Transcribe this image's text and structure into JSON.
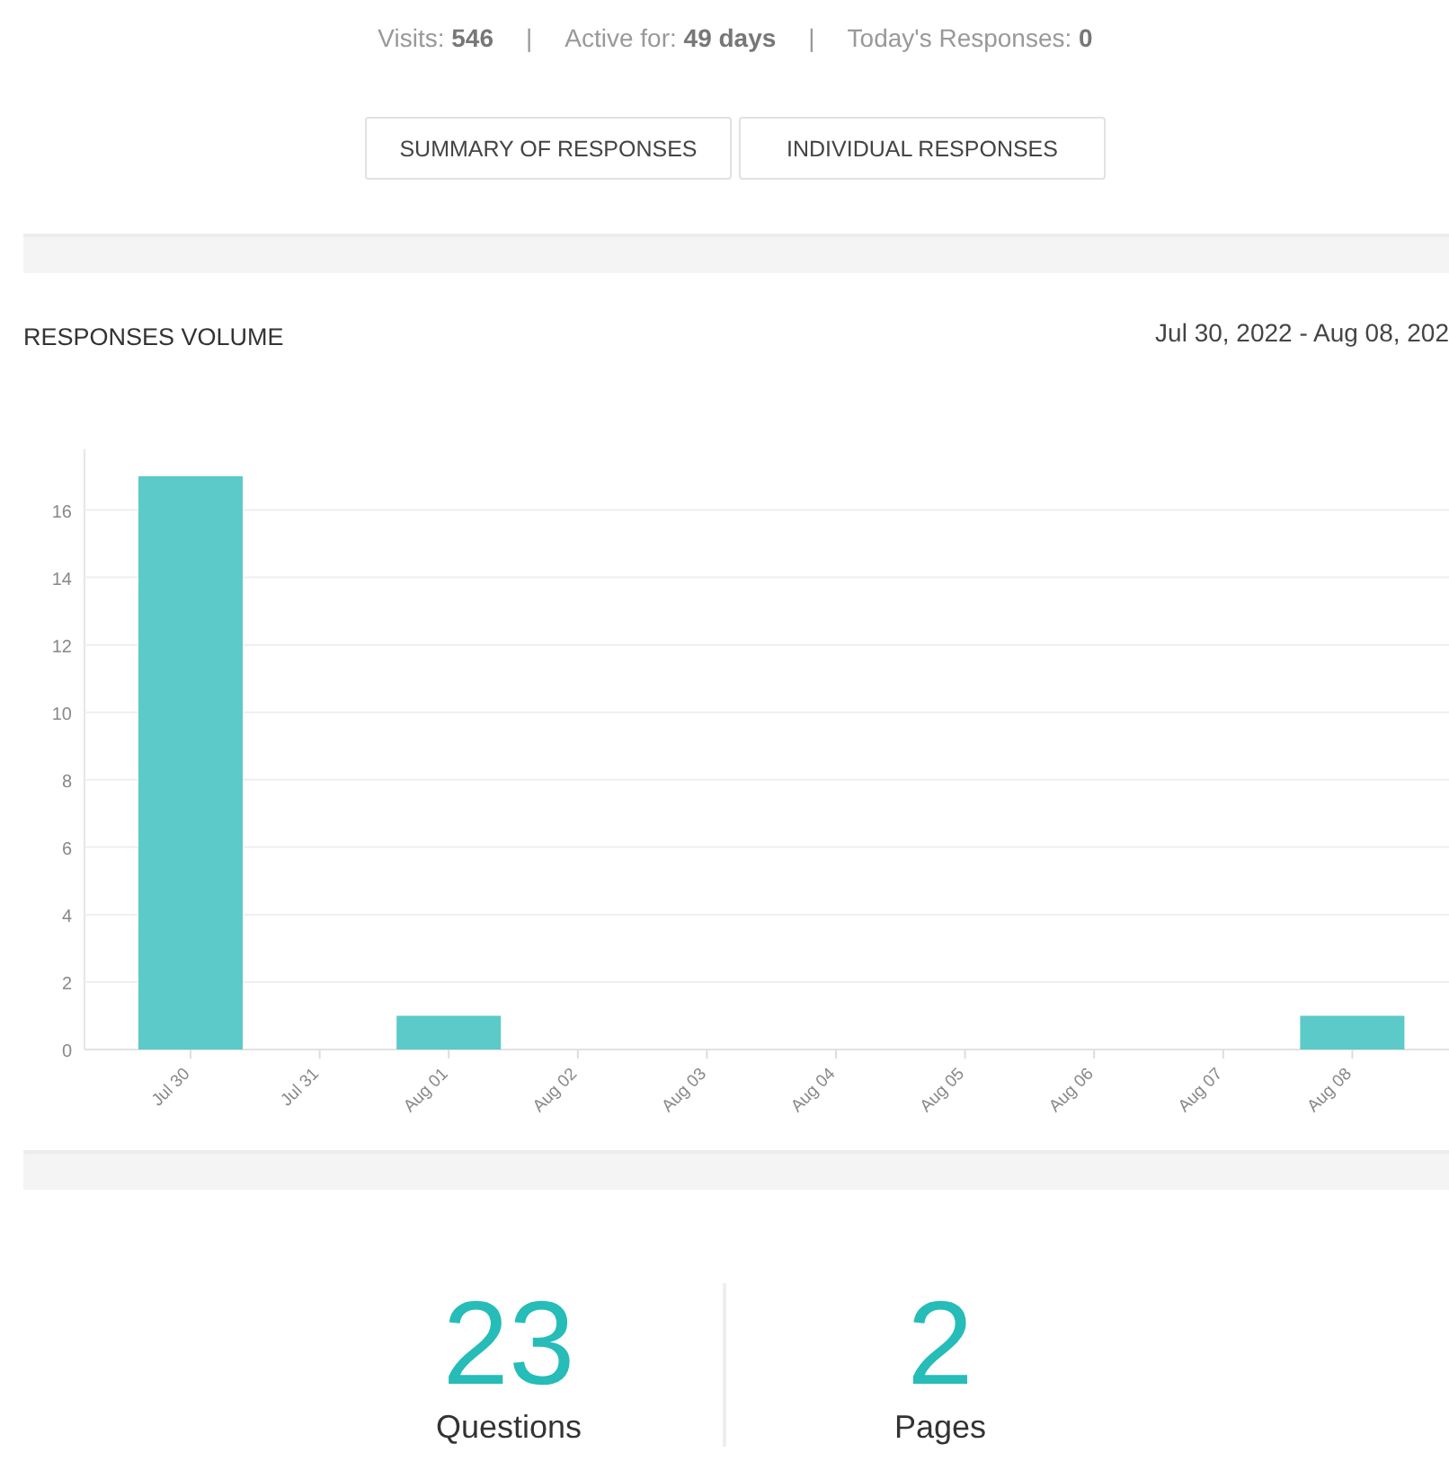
{
  "stats": [
    {
      "label": "Visits:",
      "value": "546"
    },
    {
      "label": "Active for:",
      "value": "49 days"
    },
    {
      "label": "Today's Responses:",
      "value": "0"
    }
  ],
  "separator": "|",
  "view_tabs": [
    {
      "label": "SUMMARY OF RESPONSES"
    },
    {
      "label": "INDIVIDUAL RESPONSES"
    }
  ],
  "volume": {
    "title": "RESPONSES VOLUME",
    "date_range": "Jul 30, 2022 - Aug 08, 202",
    "chart_data": {
      "type": "bar",
      "categories": [
        "Jul 30",
        "Jul 31",
        "Aug 01",
        "Aug 02",
        "Aug 03",
        "Aug 04",
        "Aug 05",
        "Aug 06",
        "Aug 07",
        "Aug 08"
      ],
      "series": [
        {
          "color": "#5bcac8",
          "values": [
            17,
            0,
            1,
            0,
            0,
            0,
            0,
            0,
            0,
            1
          ]
        }
      ],
      "ylim": [
        0,
        17.8
      ],
      "grid": true,
      "yticks": [
        0,
        2,
        4,
        6,
        8,
        10,
        12,
        14,
        16
      ]
    }
  },
  "totals": [
    {
      "value": "23",
      "label": "Questions"
    },
    {
      "value": "2",
      "label": "Pages"
    }
  ]
}
